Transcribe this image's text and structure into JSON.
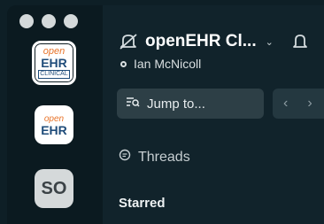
{
  "window": {
    "traffic_lights": [
      "close",
      "minimize",
      "zoom"
    ]
  },
  "workspaces": [
    {
      "line1": "open",
      "line2": "EHR",
      "line3": "CLINICAL",
      "active": true
    },
    {
      "line1": "open",
      "line2": "EHR",
      "active": false
    },
    {
      "initials": "SO",
      "active": false
    }
  ],
  "header": {
    "title": "openEHR Cl...",
    "user": "Ian McNicoll",
    "icons": [
      "notifications-off-icon",
      "chevron-down-icon",
      "bell-icon"
    ]
  },
  "search": {
    "label": "Jump to...",
    "icon": "search-list-icon"
  },
  "nav": {
    "back": "‹",
    "forward": "›"
  },
  "sidebar": {
    "threads_label": "Threads",
    "starred_label": "Starred"
  }
}
